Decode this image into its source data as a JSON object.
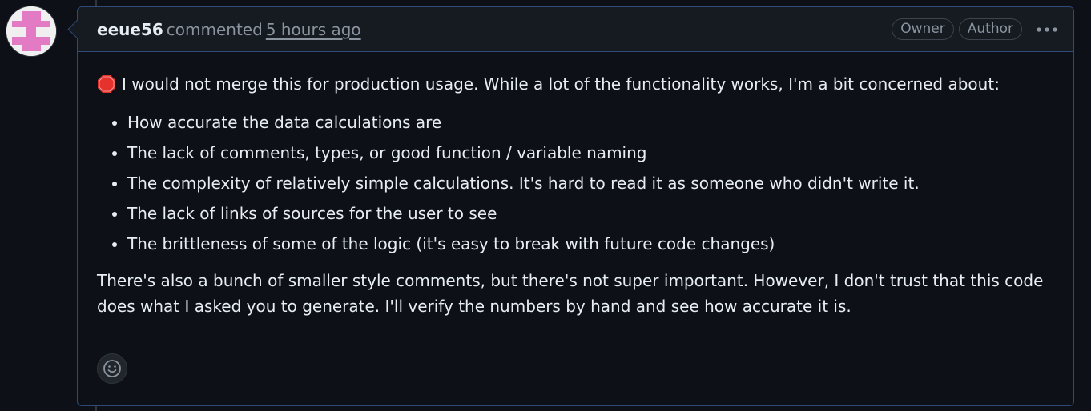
{
  "comment": {
    "author": "eeue56",
    "action": "commented",
    "timestamp": "5 hours ago",
    "badges": [
      "Owner",
      "Author"
    ],
    "intro_text": "I would not merge this for production usage. While a lot of the functionality works, I'm a bit concerned about:",
    "concerns": [
      "How accurate the data calculations are",
      "The lack of comments, types, or good function / variable naming",
      "The complexity of relatively simple calculations. It's hard to read it as someone who didn't write it.",
      "The lack of links of sources for the user to see",
      "The brittleness of some of the logic (it's easy to break with future code changes)"
    ],
    "closing_text": "There's also a bunch of smaller style comments, but there's not super important. However, I don't trust that this code does what I asked you to generate. I'll verify the numbers by hand and see how accurate it is."
  },
  "icons": {
    "stop": "stop-sign-icon",
    "kebab": "kebab-horizontal-icon",
    "reaction": "smiley-icon"
  },
  "colors": {
    "background": "#0d1117",
    "header_background": "#161b22",
    "border_highlight": "#2f4a77",
    "muted_text": "#8b949e",
    "avatar_color": "#e27bc3"
  }
}
